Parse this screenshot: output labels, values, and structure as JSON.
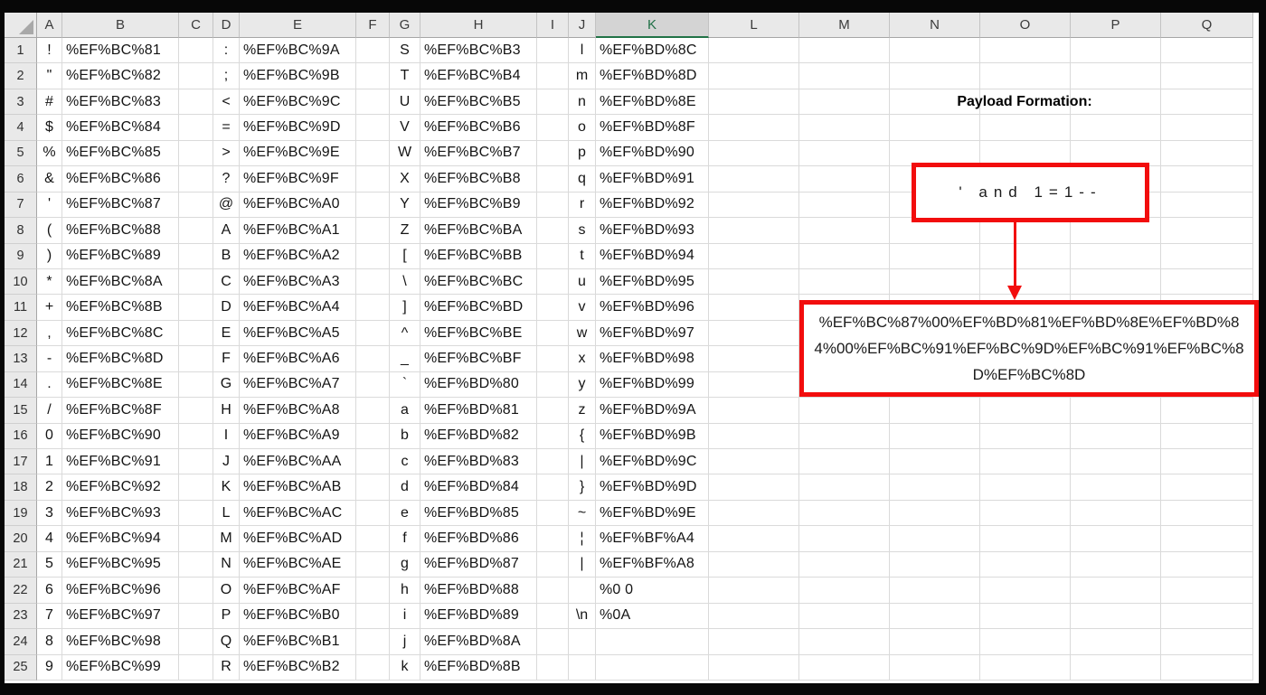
{
  "sheet": {
    "column_headers": [
      "A",
      "B",
      "C",
      "D",
      "E",
      "F",
      "G",
      "H",
      "I",
      "J",
      "K",
      "L",
      "M",
      "N",
      "O",
      "P",
      "Q"
    ],
    "selected_column": "K",
    "char_columns": [
      "A",
      "D",
      "G",
      "J"
    ],
    "code_columns": [
      "B",
      "E",
      "H",
      "K"
    ],
    "rows": [
      {
        "n": "1",
        "cells": [
          "!",
          "%EF%BC%81",
          ":",
          "%EF%BC%9A",
          "S",
          "%EF%BC%B3",
          "l",
          "%EF%BD%8C"
        ]
      },
      {
        "n": "2",
        "cells": [
          "\"",
          "%EF%BC%82",
          ";",
          "%EF%BC%9B",
          "T",
          "%EF%BC%B4",
          "m",
          "%EF%BD%8D"
        ]
      },
      {
        "n": "3",
        "cells": [
          "#",
          "%EF%BC%83",
          "<",
          "%EF%BC%9C",
          "U",
          "%EF%BC%B5",
          "n",
          "%EF%BD%8E"
        ]
      },
      {
        "n": "4",
        "cells": [
          "$",
          "%EF%BC%84",
          "=",
          "%EF%BC%9D",
          "V",
          "%EF%BC%B6",
          "o",
          "%EF%BD%8F"
        ]
      },
      {
        "n": "5",
        "cells": [
          "%",
          "%EF%BC%85",
          ">",
          "%EF%BC%9E",
          "W",
          "%EF%BC%B7",
          "p",
          "%EF%BD%90"
        ]
      },
      {
        "n": "6",
        "cells": [
          "&",
          "%EF%BC%86",
          "?",
          "%EF%BC%9F",
          "X",
          "%EF%BC%B8",
          "q",
          "%EF%BD%91"
        ]
      },
      {
        "n": "7",
        "cells": [
          "'",
          "%EF%BC%87",
          "@",
          "%EF%BC%A0",
          "Y",
          "%EF%BC%B9",
          "r",
          "%EF%BD%92"
        ]
      },
      {
        "n": "8",
        "cells": [
          "(",
          "%EF%BC%88",
          "A",
          "%EF%BC%A1",
          "Z",
          "%EF%BC%BA",
          "s",
          "%EF%BD%93"
        ]
      },
      {
        "n": "9",
        "cells": [
          ")",
          "%EF%BC%89",
          "B",
          "%EF%BC%A2",
          "[",
          "%EF%BC%BB",
          "t",
          "%EF%BD%94"
        ]
      },
      {
        "n": "10",
        "cells": [
          "*",
          "%EF%BC%8A",
          "C",
          "%EF%BC%A3",
          "\\",
          "%EF%BC%BC",
          "u",
          "%EF%BD%95"
        ]
      },
      {
        "n": "11",
        "cells": [
          "+",
          "%EF%BC%8B",
          "D",
          "%EF%BC%A4",
          "]",
          "%EF%BC%BD",
          "v",
          "%EF%BD%96"
        ]
      },
      {
        "n": "12",
        "cells": [
          ",",
          "%EF%BC%8C",
          "E",
          "%EF%BC%A5",
          "^",
          "%EF%BC%BE",
          "w",
          "%EF%BD%97"
        ]
      },
      {
        "n": "13",
        "cells": [
          "-",
          "%EF%BC%8D",
          "F",
          "%EF%BC%A6",
          "_",
          "%EF%BC%BF",
          "x",
          "%EF%BD%98"
        ]
      },
      {
        "n": "14",
        "cells": [
          ".",
          "%EF%BC%8E",
          "G",
          "%EF%BC%A7",
          "`",
          "%EF%BD%80",
          "y",
          "%EF%BD%99"
        ]
      },
      {
        "n": "15",
        "cells": [
          "/",
          "%EF%BC%8F",
          "H",
          "%EF%BC%A8",
          "a",
          "%EF%BD%81",
          "z",
          "%EF%BD%9A"
        ]
      },
      {
        "n": "16",
        "cells": [
          "0",
          "%EF%BC%90",
          "I",
          "%EF%BC%A9",
          "b",
          "%EF%BD%82",
          "{",
          "%EF%BD%9B"
        ]
      },
      {
        "n": "17",
        "cells": [
          "1",
          "%EF%BC%91",
          "J",
          "%EF%BC%AA",
          "c",
          "%EF%BD%83",
          "|",
          "%EF%BD%9C"
        ]
      },
      {
        "n": "18",
        "cells": [
          "2",
          "%EF%BC%92",
          "K",
          "%EF%BC%AB",
          "d",
          "%EF%BD%84",
          "}",
          "%EF%BD%9D"
        ]
      },
      {
        "n": "19",
        "cells": [
          "3",
          "%EF%BC%93",
          "L",
          "%EF%BC%AC",
          "e",
          "%EF%BD%85",
          "~",
          "%EF%BD%9E"
        ]
      },
      {
        "n": "20",
        "cells": [
          "4",
          "%EF%BC%94",
          "M",
          "%EF%BC%AD",
          "f",
          "%EF%BD%86",
          "¦",
          "%EF%BF%A4"
        ]
      },
      {
        "n": "21",
        "cells": [
          "5",
          "%EF%BC%95",
          "N",
          "%EF%BC%AE",
          "g",
          "%EF%BD%87",
          "|",
          "%EF%BF%A8"
        ]
      },
      {
        "n": "22",
        "cells": [
          "6",
          "%EF%BC%96",
          "O",
          "%EF%BC%AF",
          "h",
          "%EF%BD%88",
          "",
          "%0 0"
        ]
      },
      {
        "n": "23",
        "cells": [
          "7",
          "%EF%BC%97",
          "P",
          "%EF%BC%B0",
          "i",
          "%EF%BD%89",
          "\\n",
          "%0A"
        ]
      },
      {
        "n": "24",
        "cells": [
          "8",
          "%EF%BC%98",
          "Q",
          "%EF%BC%B1",
          "j",
          "%EF%BD%8A",
          "",
          ""
        ]
      },
      {
        "n": "25",
        "cells": [
          "9",
          "%EF%BC%99",
          "R",
          "%EF%BC%B2",
          "k",
          "%EF%BD%8B",
          "",
          ""
        ]
      }
    ]
  },
  "annotation": {
    "title": "Payload Formation:",
    "decoded_payload": "' and 1=1--",
    "encoded_payload": "%EF%BC%87%00%EF%BD%81%EF%BD%8E%EF%BD%84%00%EF%BC%91%EF%BC%9D%EF%BC%91%EF%BC%8D%EF%BC%8D",
    "box_color": "#f20d0d",
    "selected_header_color": "#217346"
  }
}
